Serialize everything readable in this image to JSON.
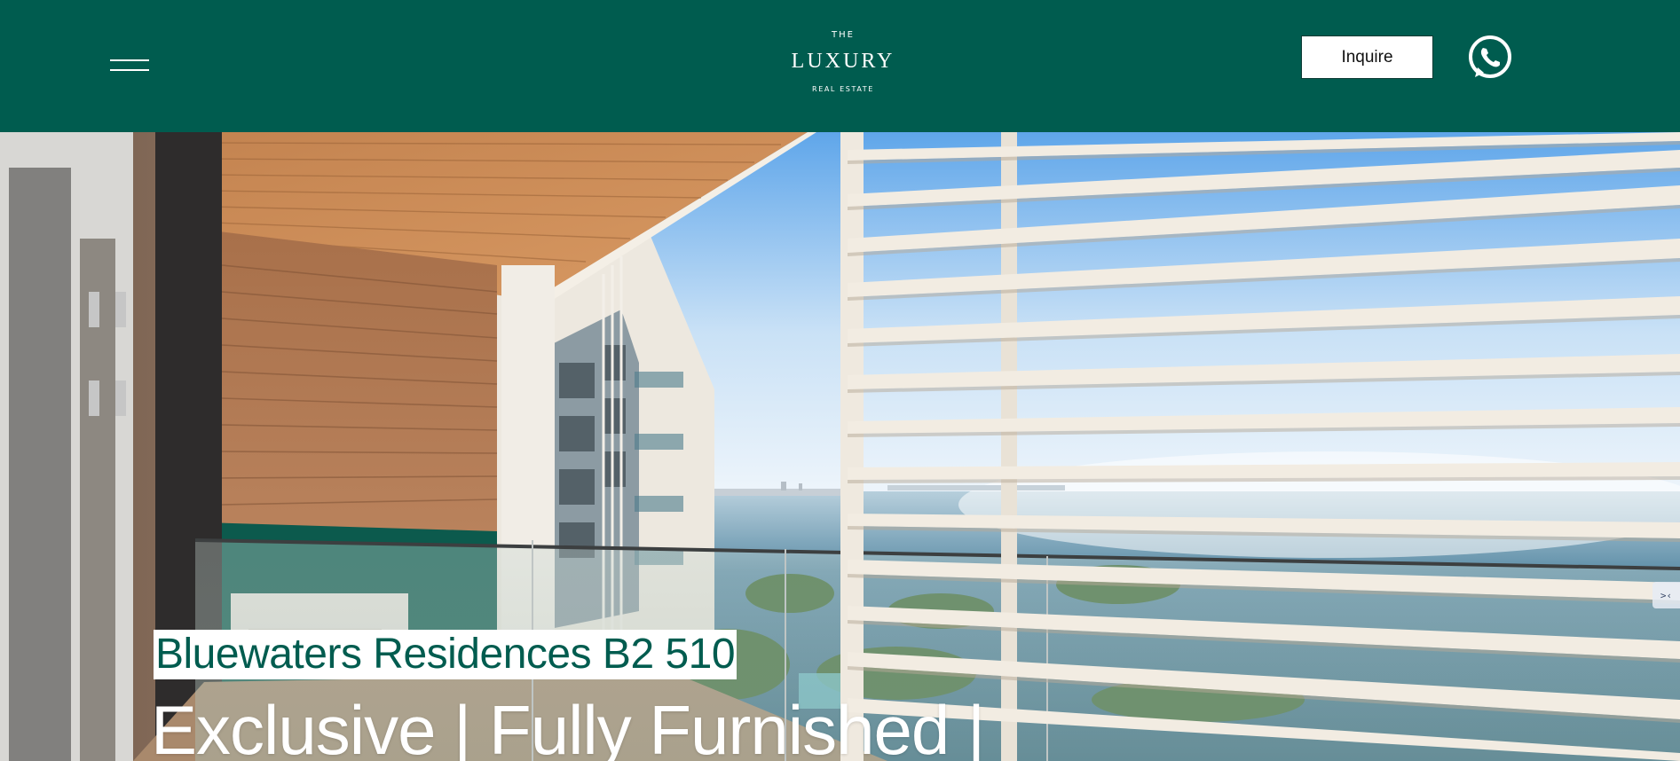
{
  "header": {
    "logo": {
      "line1": "THE",
      "line2": "LUXURY",
      "line3": "REAL ESTATE"
    },
    "inquire_label": "Inquire",
    "icons": {
      "menu": "hamburger-menu-icon",
      "whatsapp": "whatsapp-icon"
    }
  },
  "hero": {
    "title": "Bluewaters Residences B2 510",
    "subtitle": "Exclusive | Fully Furnished |",
    "side_tab_icon": "collapse-arrows-icon",
    "side_tab_glyph": ">‹"
  },
  "colors": {
    "header_bg": "#005c4f",
    "title_text": "#005c4f",
    "title_highlight": "#ffffff",
    "button_bg": "#ffffff"
  }
}
